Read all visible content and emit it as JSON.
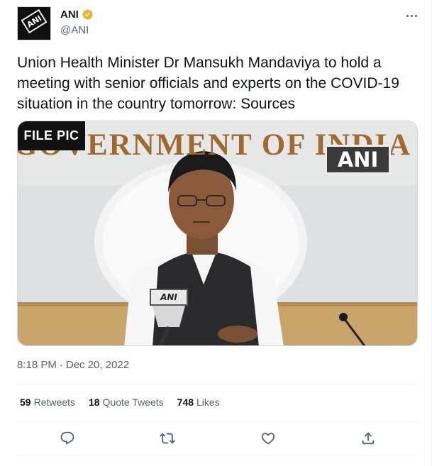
{
  "author": {
    "name": "ANI",
    "handle": "@ANI",
    "avatar_text": "ANI",
    "verified_icon": "verified-badge-icon",
    "verified_color": "#e8b32c"
  },
  "tweet": {
    "text": "Union Health Minister Dr Mansukh Mandaviya to hold a meeting with senior officials and experts on the COVID-19 situation in the country tomorrow: Sources"
  },
  "media": {
    "file_pic_label": "FILE PIC",
    "watermark": "ANI",
    "backdrop_text": "GOVERNMENT OF INDIA",
    "mic_label": "ANI"
  },
  "meta": {
    "time": "8:18 PM",
    "separator": "·",
    "date": "Dec 20, 2022"
  },
  "stats": [
    {
      "count": "59",
      "label": "Retweets"
    },
    {
      "count": "18",
      "label": "Quote Tweets"
    },
    {
      "count": "748",
      "label": "Likes"
    }
  ],
  "actions": [
    "reply-icon",
    "retweet-icon",
    "like-icon",
    "share-icon"
  ],
  "colors": {
    "text_primary": "#0f1419",
    "text_secondary": "#536471",
    "divider": "#eff3f4"
  }
}
